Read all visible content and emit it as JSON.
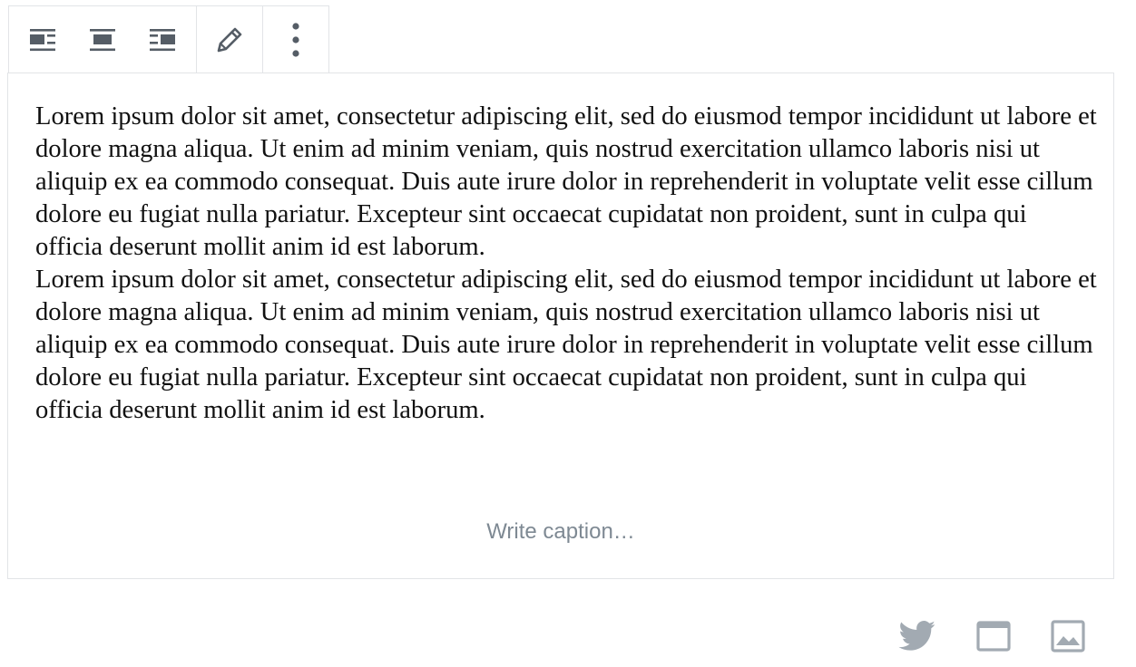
{
  "toolbar": {
    "buttons": [
      {
        "icon": "align-left-icon"
      },
      {
        "icon": "align-center-icon"
      },
      {
        "icon": "align-right-icon"
      },
      {
        "icon": "edit-pencil-icon"
      },
      {
        "icon": "more-options-icon"
      }
    ]
  },
  "embed": {
    "paragraphs": [
      "Lorem ipsum dolor sit amet, consectetur adipiscing elit, sed do eiusmod tempor incididunt ut labore et dolore magna aliqua. Ut enim ad minim veniam, quis nostrud exercitation ullamco laboris nisi ut aliquip ex ea commodo consequat. Duis aute irure dolor in reprehenderit in voluptate velit esse cillum dolore eu fugiat nulla pariatur. Excepteur sint occaecat cupidatat non proident, sunt in culpa qui officia deserunt mollit anim id est laborum.",
      "Lorem ipsum dolor sit amet, consectetur adipiscing elit, sed do eiusmod tempor incididunt ut labore et dolore magna aliqua. Ut enim ad minim veniam, quis nostrud exercitation ullamco laboris nisi ut aliquip ex ea commodo consequat. Duis aute irure dolor in reprehenderit in voluptate velit esse cillum dolore eu fugiat nulla pariatur. Excepteur sint occaecat cupidatat non proident, sunt in culpa qui officia deserunt mollit anim id est laborum."
    ],
    "caption_placeholder": "Write caption…"
  },
  "footer_icons": [
    "twitter-icon",
    "browser-window-icon",
    "image-icon"
  ],
  "colors": {
    "border": "#e2e4e7",
    "icon": "#555d66",
    "muted_icon": "#a2aab2",
    "caption": "#7e8993",
    "text": "#111111"
  }
}
